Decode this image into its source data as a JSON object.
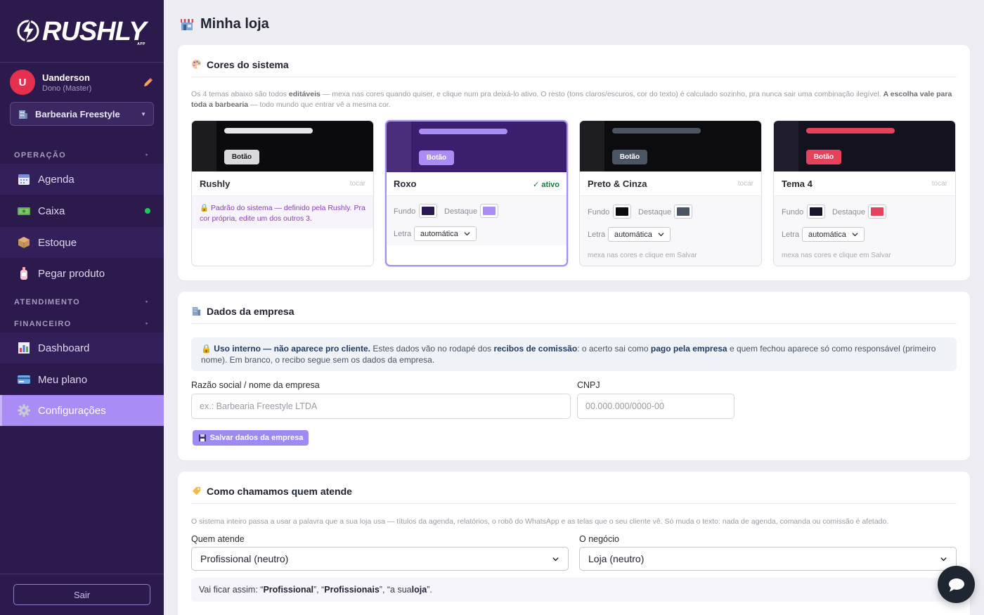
{
  "brand": {
    "logo_text": "RUSHLY",
    "logo_sub": "APP"
  },
  "user": {
    "initial": "U",
    "name": "Uanderson",
    "role": "Dono (Master)"
  },
  "shop_select": {
    "value": "Barbearia Freestyle"
  },
  "sidebar": {
    "sections": {
      "operacao": "OPERAÇÃO",
      "atendimento": "ATENDIMENTO",
      "financeiro": "FINANCEIRO"
    },
    "items": {
      "agenda": "Agenda",
      "caixa": "Caixa",
      "estoque": "Estoque",
      "pegar_produto": "Pegar produto",
      "dashboard": "Dashboard",
      "meu_plano": "Meu plano",
      "configuracoes": "Configurações"
    },
    "logout": "Sair"
  },
  "page": {
    "title": "Minha loja"
  },
  "colors_card": {
    "title": "Cores do sistema",
    "desc_1": "Os 4 temas abaixo são todos ",
    "desc_b1": "editáveis",
    "desc_2": " — mexa nas cores quando quiser, e clique num pra deixá-lo ativo. O resto (tons claros/escuros, cor do texto) é calculado sozinho, pra nunca sair uma combinação ilegível. ",
    "desc_b2": "A escolha vale para toda a barbearia",
    "desc_3": " — todo mundo que entrar vê a mesma cor.",
    "preview_button": "Botão",
    "labels": {
      "fundo": "Fundo",
      "destaque": "Destaque",
      "letra": "Letra"
    },
    "letra_value": "automática",
    "hint": "mexa nas cores e clique em Salvar",
    "themes": [
      {
        "name": "Rushly",
        "tag": "tocar",
        "lock_note": "🔒 Padrão do sistema — definido pela Rushly. Pra cor própria, edite um dos outros 3.",
        "bg": "#0b0b0f",
        "side": "#1b1b20",
        "bar": "#e6e6ea",
        "btn": "#d9d9de",
        "btn_text": "#1f1f24"
      },
      {
        "name": "Roxo",
        "tag": "✓ ativo",
        "bg": "#3b1e6e",
        "side": "#4a2e7c",
        "bar": "#a98df5",
        "btn": "#a98df5",
        "btn_text": "#ffffff",
        "fundo": "#2a1852",
        "destaque": "#a98df5"
      },
      {
        "name": "Preto & Cinza",
        "tag": "tocar",
        "bg": "#0c0c0e",
        "side": "#1e1e22",
        "bar": "#4b5563",
        "btn": "#4b5563",
        "btn_text": "#ffffff",
        "fundo": "#0c0c0e",
        "destaque": "#4b5563"
      },
      {
        "name": "Tema 4",
        "tag": "tocar",
        "bg": "#14121f",
        "side": "#1f1d2c",
        "bar": "#e5435c",
        "btn": "#e5435c",
        "btn_text": "#ffffff",
        "fundo": "#16142a",
        "destaque": "#e5435c"
      }
    ]
  },
  "company_card": {
    "title": "Dados da empresa",
    "info_b1": "🔒 Uso interno — não aparece pro cliente.",
    "info_1": " Estes dados vão no rodapé dos ",
    "info_b2": "recibos de comissão",
    "info_2": ": o acerto sai como ",
    "info_b3": "pago pela empresa",
    "info_3": " e quem fechou aparece só como responsável (primeiro nome). Em branco, o recibo segue sem os dados da empresa.",
    "razao_label": "Razão social / nome da empresa",
    "razao_placeholder": "ex.: Barbearia Freestyle LTDA",
    "cnpj_label": "CNPJ",
    "cnpj_placeholder": "00.000.000/0000-00",
    "save_label": "Salvar dados da empresa"
  },
  "naming_card": {
    "title": "Como chamamos quem atende",
    "desc": "O sistema inteiro passa a usar a palavra que a sua loja usa — títulos da agenda, relatórios, o robô do WhatsApp e as telas que o seu cliente vê. Só muda o texto: nada de agenda, comanda ou comissão é afetado.",
    "quem_label": "Quem atende",
    "quem_value": "Profissional (neutro)",
    "negocio_label": "O negócio",
    "negocio_value": "Loja (neutro)",
    "preview_1": "Vai ficar assim: “",
    "preview_b1": "Profissional",
    "preview_2": "”, “",
    "preview_b2": "Profissionais",
    "preview_3": "”, “a sua ",
    "preview_b3": "loja",
    "preview_4": "”."
  },
  "colors": {
    "sidebar": "#2c1a4d",
    "accent": "#a98df5",
    "page_bg": "#eeedf4"
  }
}
